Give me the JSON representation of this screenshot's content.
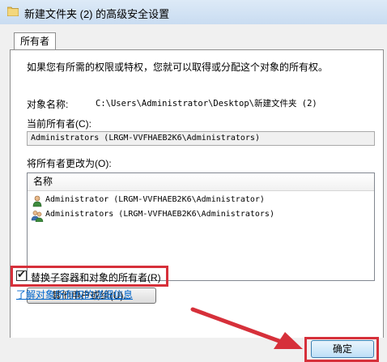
{
  "window": {
    "title": "新建文件夹 (2) 的高级安全设置"
  },
  "tabs": [
    "所有者"
  ],
  "intro_text": "如果您有所需的权限或特权，您就可以取得或分配这个对象的所有权。",
  "object_name": {
    "label": "对象名称:",
    "value": "C:\\Users\\Administrator\\Desktop\\新建文件夹 (2)"
  },
  "current_owner": {
    "label": "当前所有者(C):",
    "value": "Administrators (LRGM-VVFHAEB2K6\\Administrators)"
  },
  "change_owner": {
    "label": "将所有者更改为(O):",
    "column_header": "名称",
    "items": [
      {
        "name": "Administrator (LRGM-VVFHAEB2K6\\Administrator)",
        "icon": "user-icon"
      },
      {
        "name": "Administrators (LRGM-VVFHAEB2K6\\Administrators)",
        "icon": "group-icon"
      }
    ]
  },
  "other_users_button": "其他用户或组(U)...",
  "replace_owner_checkbox": {
    "label": "替换子容器和对象的所有者(R)",
    "checked": true
  },
  "help_link": "了解对象所有权的详细信息",
  "ok_button": "确定",
  "colors": {
    "highlight": "#d6303a",
    "link": "#0066cc",
    "titlebar": "#c9dcf1"
  }
}
